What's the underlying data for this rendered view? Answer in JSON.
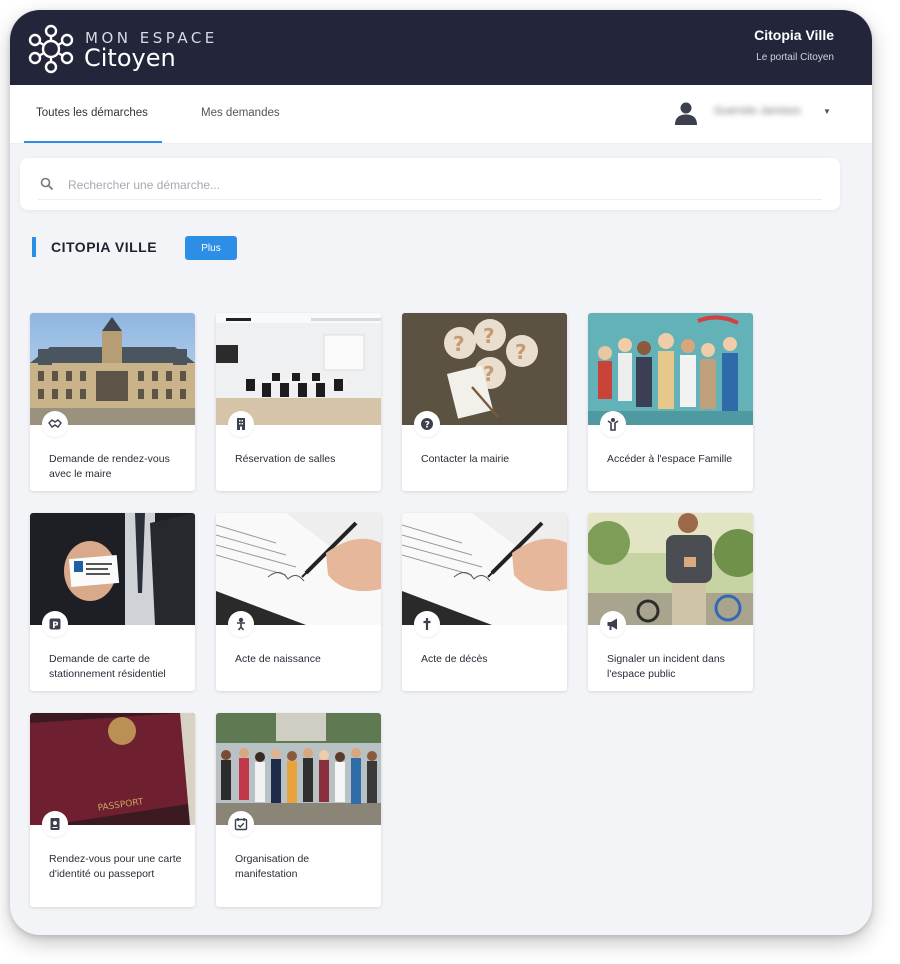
{
  "header": {
    "logo_line1": "MON ESPACE",
    "logo_line2": "Citoyen",
    "org_name": "Citopia Ville",
    "org_subtitle": "Le portail Citoyen"
  },
  "nav": {
    "tabs": [
      {
        "label": "Toutes les démarches",
        "active": true
      },
      {
        "label": "Mes demandes",
        "active": false
      }
    ],
    "user": {
      "name": "Guerrelo Jamison",
      "icon": "user-icon"
    }
  },
  "search": {
    "placeholder": "Rechercher une démarche...",
    "value": ""
  },
  "section": {
    "title": "CITOPIA VILLE",
    "more_label": "Plus"
  },
  "cards": [
    {
      "title": "Demande de rendez-vous avec le maire",
      "icon": "handshake-icon"
    },
    {
      "title": "Réservation de salles",
      "icon": "building-icon"
    },
    {
      "title": "Contacter la mairie",
      "icon": "question-icon"
    },
    {
      "title": "Accéder à l'espace Famille",
      "icon": "child-icon"
    },
    {
      "title": "Demande de carte de stationnement résidentiel",
      "icon": "parking-icon"
    },
    {
      "title": "Acte de naissance",
      "icon": "baby-icon"
    },
    {
      "title": "Acte de décès",
      "icon": "cross-icon"
    },
    {
      "title": "Signaler un incident dans l'espace public",
      "icon": "megaphone-icon"
    },
    {
      "title": "Rendez-vous pour une carte d'identité ou passeport",
      "icon": "passport-icon"
    },
    {
      "title": "Organisation de manifestation",
      "icon": "calendar-check-icon"
    }
  ],
  "colors": {
    "header_bg": "#23263a",
    "accent": "#2e8ee6",
    "page_bg": "#f3f4f7"
  }
}
